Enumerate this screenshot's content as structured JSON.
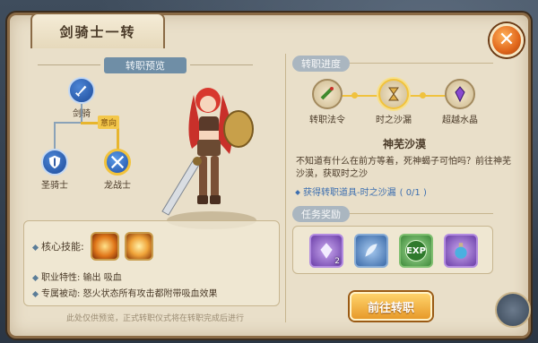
{
  "window": {
    "title": "剑骑士一转",
    "close_symbol": "✕"
  },
  "left": {
    "preview_header": "转职预览",
    "tree": {
      "root": "剑骑",
      "intent_badge": "意向",
      "children": [
        "圣骑士",
        "龙战士"
      ]
    },
    "skills": {
      "core_label": "核心技能:",
      "trait_line": "职业特性: 输出 吸血",
      "passive_line": "专属被动: 怒火状态所有攻击都附带吸血效果"
    },
    "footer_note": "此处仅供预览，正式转职仪式将在转职完成后进行"
  },
  "right": {
    "progress_header": "转职进度",
    "progress_items": [
      "转职法令",
      "时之沙漏",
      "超越水晶"
    ],
    "desc_title": "神芜沙漠",
    "desc_text": "不知道有什么在前方等着，死神蝎子可怕吗？前往神芜沙漠，获取时之沙",
    "task_text": "获得转职道具-时之沙漏",
    "task_count": "( 0/1 )",
    "reward_header": "任务奖励",
    "rewards": {
      "first_count": "2",
      "exp_label": "EXP"
    },
    "go_button": "前往转职"
  },
  "colors": {
    "accent": "#f0c23e",
    "panel": "#e9dfc9",
    "task_link": "#3d6fb0"
  }
}
